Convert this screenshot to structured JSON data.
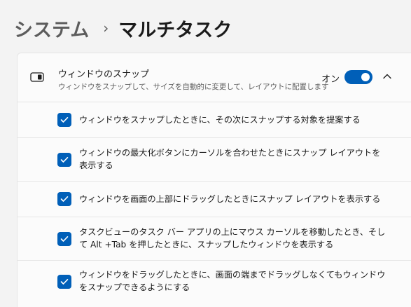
{
  "breadcrumb": {
    "parent": "システム",
    "separator": "›",
    "current": "マルチタスク"
  },
  "snap_section": {
    "icon": "snap-layout-icon",
    "title": "ウィンドウのスナップ",
    "description": "ウィンドウをスナップして、サイズを自動的に変更して、レイアウトに配置します",
    "toggle_label": "オン",
    "toggle_on": true,
    "expanded": true,
    "options": [
      {
        "label": "ウィンドウをスナップしたときに、その次にスナップする対象を提案する",
        "checked": true
      },
      {
        "label": "ウィンドウの最大化ボタンにカーソルを合わせたときにスナップ レイアウトを表示する",
        "checked": true
      },
      {
        "label": "ウィンドウを画面の上部にドラッグしたときにスナップ レイアウトを表示する",
        "checked": true
      },
      {
        "label": "タスクビューのタスク バー アプリの上にマウス カーソルを移動したとき、そして Alt +Tab を押したときに、スナップしたウィンドウを表示する",
        "checked": true
      },
      {
        "label": "ウィンドウをドラッグしたときに、画面の端までドラッグしなくてもウィンドウをスナップできるようにする",
        "checked": true
      }
    ]
  },
  "colors": {
    "accent": "#005fb8",
    "background": "#f3f3f3",
    "card": "#fbfbfb"
  }
}
